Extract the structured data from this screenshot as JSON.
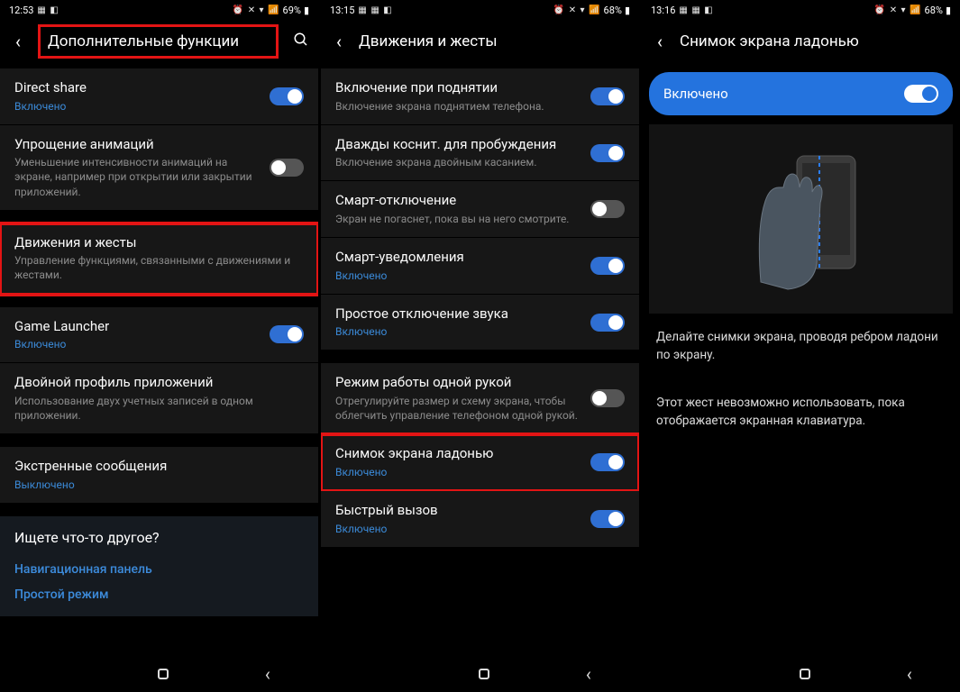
{
  "screen1": {
    "status": {
      "time": "12:53",
      "battery": "69%"
    },
    "title": "Дополнительные функции",
    "items": [
      {
        "title": "Direct share",
        "sub": "Включено",
        "subLink": true,
        "toggle": "on"
      },
      {
        "title": "Упрощение анимаций",
        "sub": "Уменьшение интенсивности анимаций на экране, например при открытии или закрытии приложений.",
        "toggle": "off"
      },
      {
        "title": "Движения и жесты",
        "sub": "Управление функциями, связанными с движениями и жестами.",
        "highlight": true
      },
      {
        "title": "Game Launcher",
        "sub": "Включено",
        "subLink": true,
        "toggle": "on"
      },
      {
        "title": "Двойной профиль приложений",
        "sub": "Использование двух учетных записей в одном приложении."
      },
      {
        "title": "Экстренные сообщения",
        "sub": "Выключено",
        "subLink": true
      }
    ],
    "suggest": {
      "title": "Ищете что-то другое?",
      "links": [
        "Навигационная панель",
        "Простой режим"
      ]
    }
  },
  "screen2": {
    "status": {
      "time": "13:15",
      "battery": "68%"
    },
    "title": "Движения и жесты",
    "items": [
      {
        "title": "Включение при поднятии",
        "sub": "Включение экрана поднятием телефона.",
        "toggle": "on"
      },
      {
        "title": "Дважды коснит. для пробуждения",
        "sub": "Включение экрана двойным касанием.",
        "toggle": "on"
      },
      {
        "title": "Смарт-отключение",
        "sub": "Экран не погаснет, пока вы на него смотрите.",
        "toggle": "off"
      },
      {
        "title": "Смарт-уведомления",
        "sub": "Включено",
        "subLink": true,
        "toggle": "on"
      },
      {
        "title": "Простое отключение звука",
        "sub": "Включено",
        "subLink": true,
        "toggle": "on"
      },
      {
        "title": "Режим работы одной рукой",
        "sub": "Отрегулируйте размер и схему экрана, чтобы облегчить управление телефоном одной рукой.",
        "toggle": "off"
      },
      {
        "title": "Снимок экрана ладонью",
        "sub": "Включено",
        "subLink": true,
        "toggle": "on",
        "highlight": true
      },
      {
        "title": "Быстрый вызов",
        "sub": "Включено",
        "subLink": true,
        "toggle": "on"
      }
    ]
  },
  "screen3": {
    "status": {
      "time": "13:16",
      "battery": "68%"
    },
    "title": "Снимок экрана ладонью",
    "enabled": "Включено",
    "help1": "Делайте снимки экрана, проводя ребром ладони по экрану.",
    "help2": "Этот жест невозможно использовать, пока отображается экранная клавиатура."
  }
}
